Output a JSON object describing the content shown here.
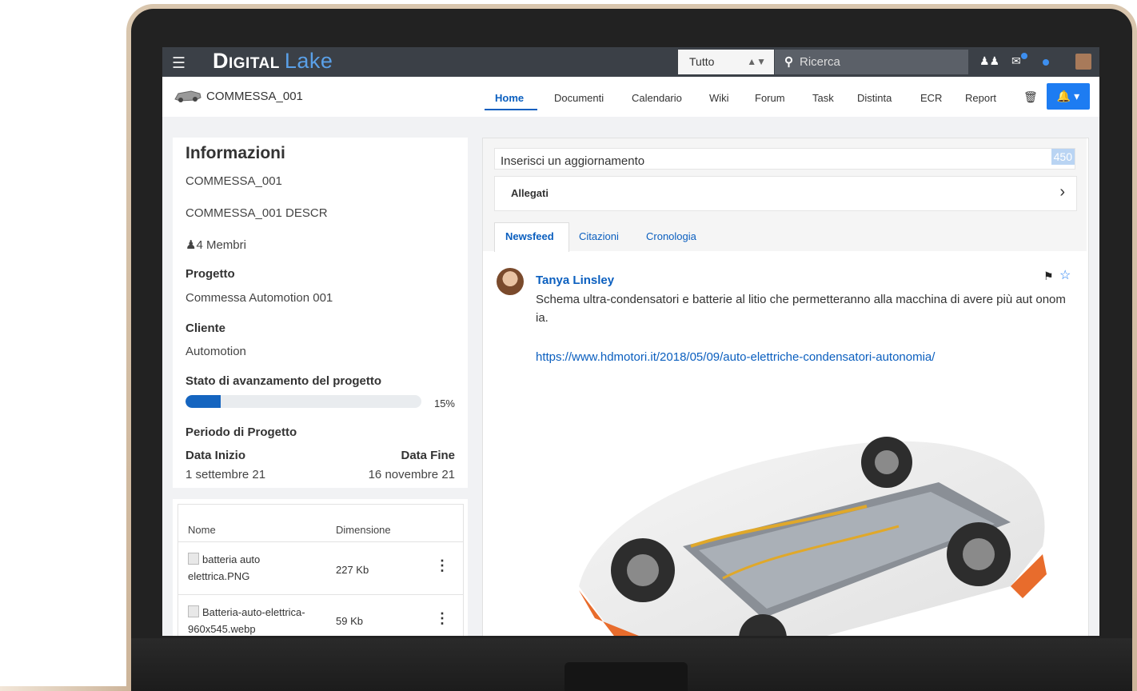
{
  "app": {
    "logo_main": "Digital",
    "logo_accent": "Lake"
  },
  "topbar": {
    "scope_select": "Tutto",
    "search_placeholder": "Ricerca"
  },
  "subbar": {
    "project_code": "COMMESSA_001",
    "nav": [
      "Home",
      "Documenti",
      "Calendario",
      "Wiki",
      "Forum",
      "Task",
      "Distinta",
      "ECR",
      "Report"
    ],
    "active_nav": "Home"
  },
  "info": {
    "title": "Informazioni",
    "code": "COMMESSA_001",
    "description": "COMMESSA_001 DESCR",
    "members": "4 Membri",
    "project_label": "Progetto",
    "project_value": "Commessa Automotion 001",
    "client_label": "Cliente",
    "client_value": "Automotion",
    "progress_label": "Stato di avanzamento del progetto",
    "progress_value": 0.15,
    "progress_text": "15%",
    "period_label": "Periodo di Progetto",
    "start_label": "Data Inizio",
    "end_label": "Data Fine",
    "start_value": "1 settembre 21",
    "end_value": "16 novembre 21"
  },
  "files": {
    "headers": [
      "Nome",
      "Dimensione"
    ],
    "rows": [
      {
        "name": "batteria auto elettrica.PNG",
        "size": "227 Kb"
      },
      {
        "name": "Batteria-auto-elettrica-960x545.webp",
        "size": "59 Kb"
      }
    ]
  },
  "feed": {
    "update_placeholder": "Inserisci un aggiornamento",
    "char_count": "450",
    "attachments_label": "Allegati",
    "tabs": [
      "Newsfeed",
      "Citazioni",
      "Cronologia"
    ],
    "post": {
      "author": "Tanya Linsley",
      "text": "Schema ultra-condensatori e batterie al litio che permetteranno alla macchina di avere più aut onomia.",
      "link": "https://www.hdmotori.it/2018/05/09/auto-elettriche-condensatori-autonomia/"
    }
  }
}
